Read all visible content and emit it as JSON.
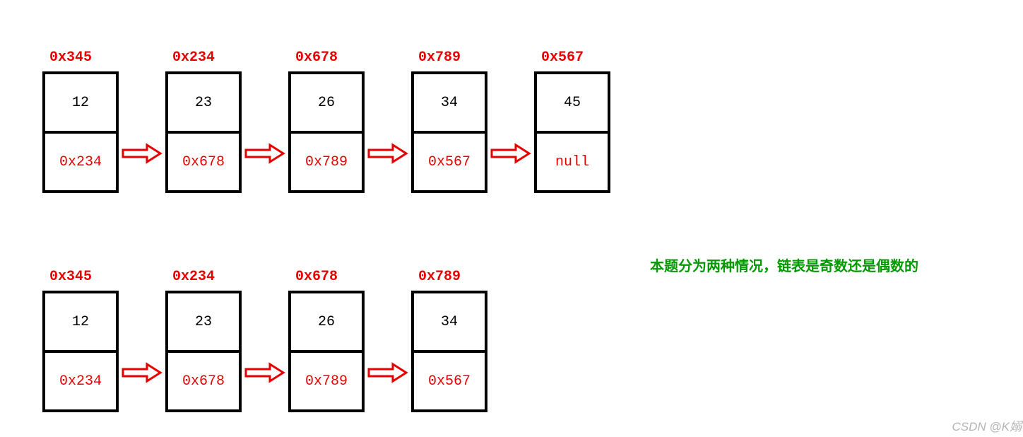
{
  "list1": {
    "nodes": [
      {
        "addr": "0x345",
        "value": "12",
        "next": "0x234"
      },
      {
        "addr": "0x234",
        "value": "23",
        "next": "0x678"
      },
      {
        "addr": "0x678",
        "value": "26",
        "next": "0x789"
      },
      {
        "addr": "0x789",
        "value": "34",
        "next": "0x567"
      },
      {
        "addr": "0x567",
        "value": "45",
        "next": "null"
      }
    ]
  },
  "list2": {
    "nodes": [
      {
        "addr": "0x345",
        "value": "12",
        "next": "0x234"
      },
      {
        "addr": "0x234",
        "value": "23",
        "next": "0x678"
      },
      {
        "addr": "0x678",
        "value": "26",
        "next": "0x789"
      },
      {
        "addr": "0x789",
        "value": "34",
        "next": "0x567"
      }
    ]
  },
  "note": "本题分为两种情况，链表是奇数还是偶数的",
  "watermark": "CSDN @K嫋"
}
